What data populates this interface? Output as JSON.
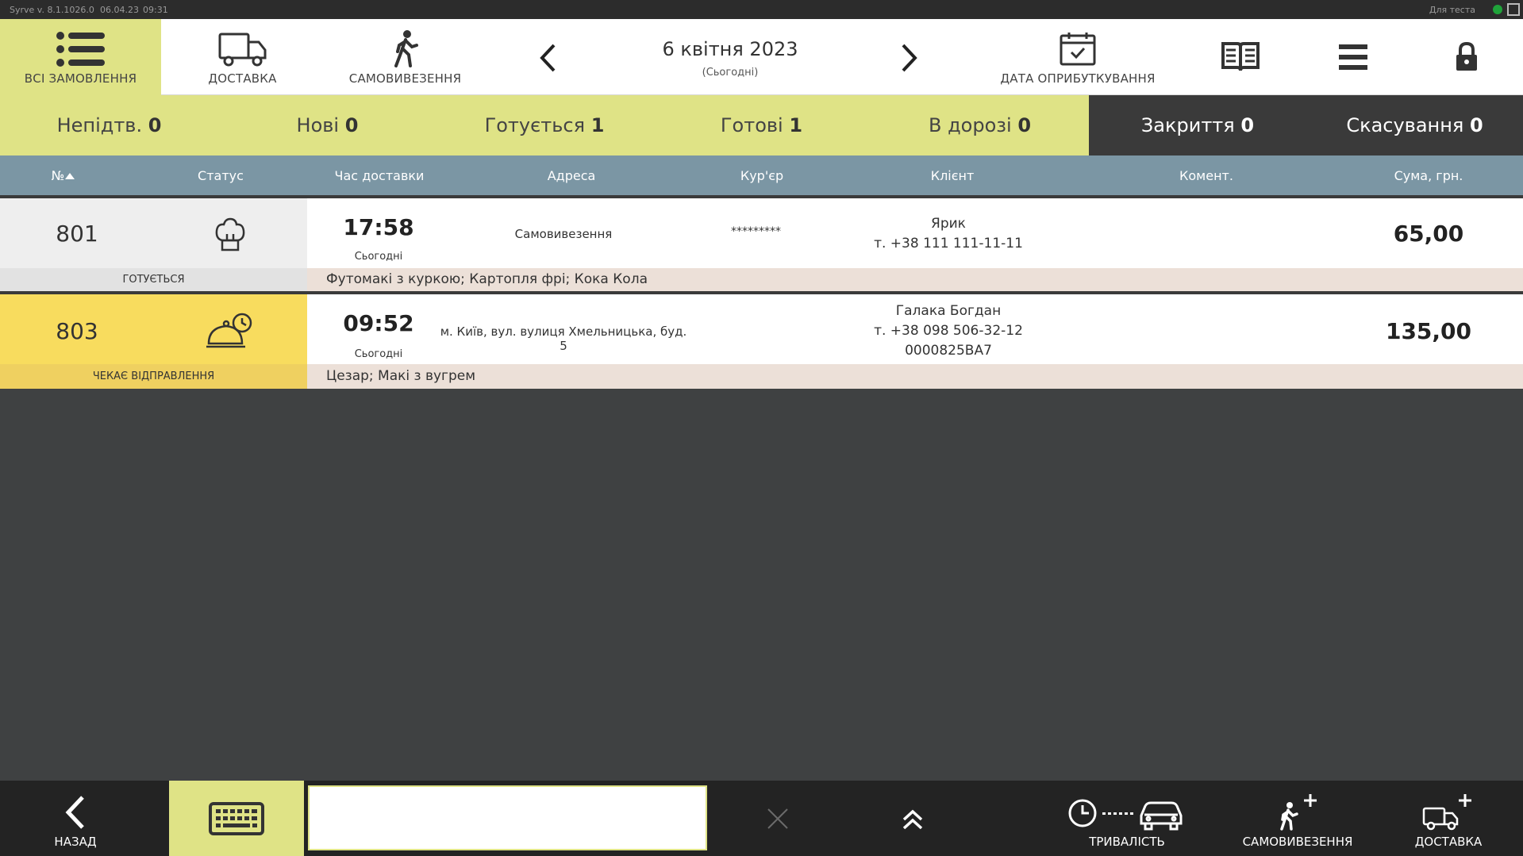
{
  "system": {
    "version": "Syrve  v. 8.1.1026.0",
    "date": "06.04.23",
    "time": "09:31",
    "right_label": "Для теста"
  },
  "toolbar": {
    "all_orders": "ВСІ ЗАМОВЛЕННЯ",
    "delivery": "ДОСТАВКА",
    "pickup": "САМОВИВЕЗЕННЯ",
    "date": "6 квітня 2023",
    "date_sub": "(Сьогодні)",
    "posting_date": "ДАТА ОПРИБУТКУВАННЯ"
  },
  "filters": [
    {
      "label": "Непідтв.",
      "count": "0"
    },
    {
      "label": "Нові",
      "count": "0"
    },
    {
      "label": "Готується",
      "count": "1"
    },
    {
      "label": "Готові",
      "count": "1"
    },
    {
      "label": "В дорозі",
      "count": "0"
    },
    {
      "label": "Закриття",
      "count": "0"
    },
    {
      "label": "Скасування",
      "count": "0"
    }
  ],
  "columns": {
    "num": "№",
    "status": "Статус",
    "time": "Час доставки",
    "address": "Адреса",
    "courier": "Кур'єр",
    "client": "Клієнт",
    "comment": "Комент.",
    "sum": "Сума, грн."
  },
  "orders": [
    {
      "num": "801",
      "status": "ГОТУЄТЬСЯ",
      "status_icon": "chef-hat-icon",
      "time": "17:58",
      "time_sub": "Сьогодні",
      "address": "Самовивезення",
      "courier": "*********",
      "client_name": "Ярик",
      "client_phone": "т. +38 111 111-11-11",
      "client_extra": "",
      "sum": "65,00",
      "items": "Футомакі з куркою; Картопля фрі; Кока Кола",
      "left_bg": "#eeeeee",
      "label_bg": "#e2e2e2"
    },
    {
      "num": "803",
      "status": "ЧЕКАЄ ВІДПРАВЛЕННЯ",
      "status_icon": "cloche-clock-icon",
      "time": "09:52",
      "time_sub": "Сьогодні",
      "address": "м. Київ, вул. вулиця Хмельницька, буд. 5",
      "courier": "",
      "client_name": "Галака Богдан",
      "client_phone": "т. +38 098 506-32-12",
      "client_extra": "0000825BA7",
      "sum": "135,00",
      "items": "Цезар; Макі з вугрем",
      "left_bg": "#f8dc5e",
      "label_bg": "#efd060"
    }
  ],
  "bottom": {
    "back": "НАЗАД",
    "search_value": "",
    "duration": "ТРИВАЛІСТЬ",
    "new_pickup": "САМОВИВЕЗЕННЯ",
    "new_delivery": "ДОСТАВКА"
  }
}
